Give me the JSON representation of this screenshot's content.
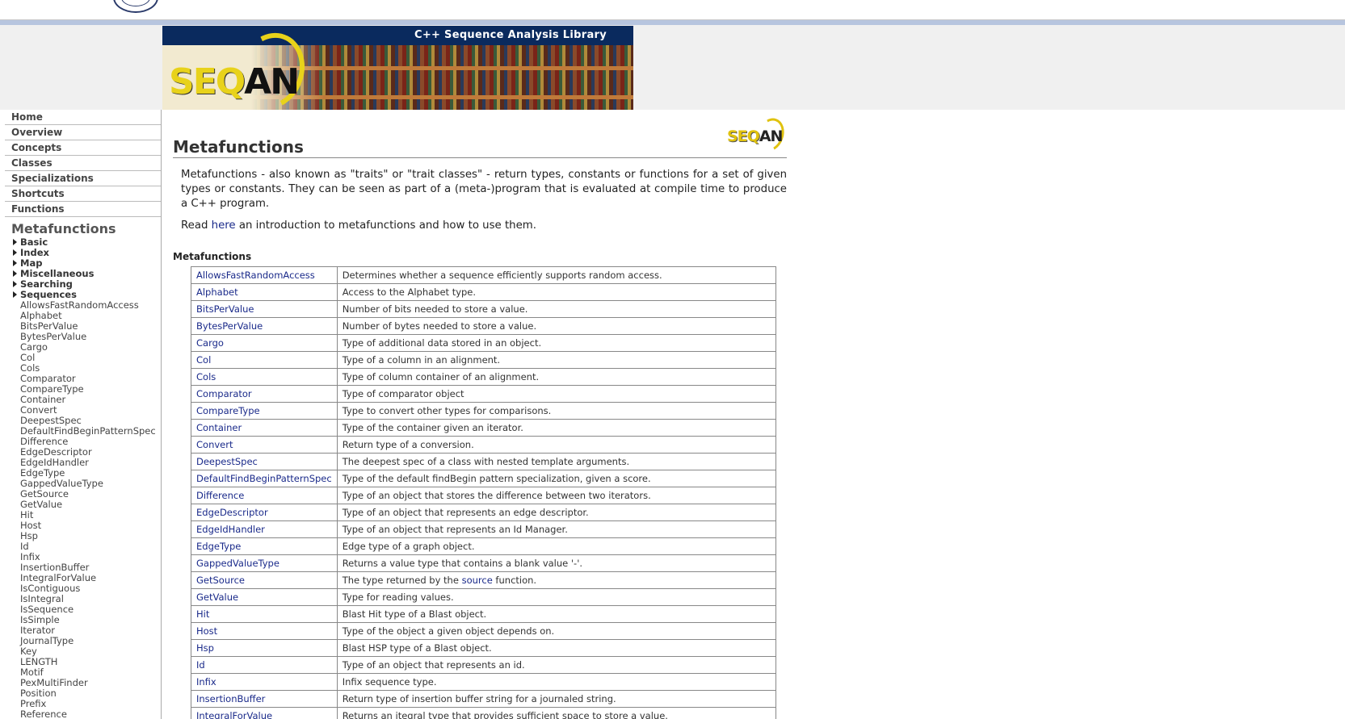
{
  "banner": {
    "title": "C++ Sequence Analysis Library",
    "logo_main": "SEQ",
    "logo_tail": "AN"
  },
  "nav": {
    "items": [
      "Home",
      "Overview",
      "Concepts",
      "Classes",
      "Specializations",
      "Shortcuts",
      "Functions"
    ],
    "section_title": "Metafunctions",
    "categories": [
      "Basic",
      "Index",
      "Map",
      "Miscellaneous",
      "Searching",
      "Sequences"
    ],
    "metafunctions": [
      "AllowsFastRandomAccess",
      "Alphabet",
      "BitsPerValue",
      "BytesPerValue",
      "Cargo",
      "Col",
      "Cols",
      "Comparator",
      "CompareType",
      "Container",
      "Convert",
      "DeepestSpec",
      "DefaultFindBeginPatternSpec",
      "Difference",
      "EdgeDescriptor",
      "EdgeIdHandler",
      "EdgeType",
      "GappedValueType",
      "GetSource",
      "GetValue",
      "Hit",
      "Host",
      "Hsp",
      "Id",
      "Infix",
      "InsertionBuffer",
      "IntegralForValue",
      "IsContiguous",
      "IsIntegral",
      "IsSequence",
      "IsSimple",
      "Iterator",
      "JournalType",
      "Key",
      "LENGTH",
      "Motif",
      "PexMultiFinder",
      "Position",
      "Prefix",
      "Reference"
    ]
  },
  "main": {
    "logo_main": "SEQ",
    "logo_tail": "AN",
    "title": "Metafunctions",
    "intro": "Metafunctions - also known as \"traits\" or \"trait classes\" - return types, constants or functions for a set of given types or constants. They can be seen as part of a (meta-)program that is evaluated at compile time to produce a C++ program.",
    "read_prefix": "Read ",
    "read_link": "here",
    "read_suffix": " an introduction to metafunctions and how to use them.",
    "section_heading": "Metafunctions",
    "rows": [
      {
        "name": "AllowsFastRandomAccess",
        "desc": "Determines whether a sequence efficiently supports random access."
      },
      {
        "name": "Alphabet",
        "desc": "Access to the Alphabet type."
      },
      {
        "name": "BitsPerValue",
        "desc": "Number of bits needed to store a value."
      },
      {
        "name": "BytesPerValue",
        "desc": "Number of bytes needed to store a value."
      },
      {
        "name": "Cargo",
        "desc": "Type of additional data stored in an object."
      },
      {
        "name": "Col",
        "desc": "Type of a column in an alignment."
      },
      {
        "name": "Cols",
        "desc": "Type of column container of an alignment."
      },
      {
        "name": "Comparator",
        "desc": "Type of comparator object"
      },
      {
        "name": "CompareType",
        "desc": "Type to convert other types for comparisons."
      },
      {
        "name": "Container",
        "desc": "Type of the container given an iterator."
      },
      {
        "name": "Convert",
        "desc": "Return type of a conversion."
      },
      {
        "name": "DeepestSpec",
        "desc": "The deepest spec of a class with nested template arguments."
      },
      {
        "name": "DefaultFindBeginPatternSpec",
        "desc": "Type of the default findBegin pattern specialization, given a score."
      },
      {
        "name": "Difference",
        "desc": "Type of an object that stores the difference between two iterators."
      },
      {
        "name": "EdgeDescriptor",
        "desc": "Type of an object that represents an edge descriptor."
      },
      {
        "name": "EdgeIdHandler",
        "desc": "Type of an object that represents an Id Manager."
      },
      {
        "name": "EdgeType",
        "desc": "Edge type of a graph object."
      },
      {
        "name": "GappedValueType",
        "desc": "Returns a value type that contains a blank value '-'."
      },
      {
        "name": "GetSource",
        "desc_pre": "The type returned by the ",
        "desc_link": "source",
        "desc_post": " function."
      },
      {
        "name": "GetValue",
        "desc": "Type for reading values."
      },
      {
        "name": "Hit",
        "desc": "Blast Hit type of a Blast object."
      },
      {
        "name": "Host",
        "desc": "Type of the object a given object depends on."
      },
      {
        "name": "Hsp",
        "desc": "Blast HSP type of a Blast object."
      },
      {
        "name": "Id",
        "desc": "Type of an object that represents an id."
      },
      {
        "name": "Infix",
        "desc": "Infix sequence type."
      },
      {
        "name": "InsertionBuffer",
        "desc": "Return type of insertion buffer string for a journaled string."
      },
      {
        "name": "IntegralForValue",
        "desc": "Returns an itegral type that provides sufficient space to store a value."
      }
    ]
  }
}
